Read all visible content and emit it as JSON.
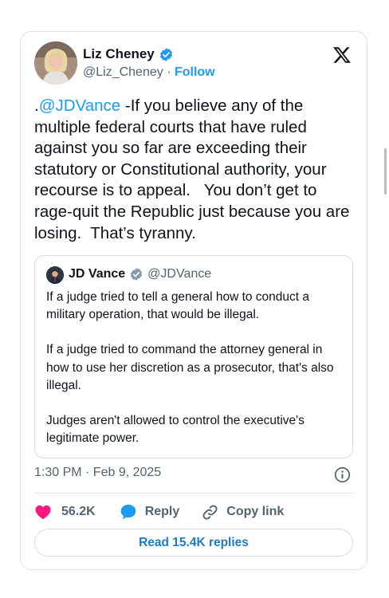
{
  "tweet": {
    "author": {
      "name": "Liz Cheney",
      "handle": "@Liz_Cheney",
      "separator": " · ",
      "follow_label": "Follow",
      "avatar_icon": "person-portrait",
      "verified_icon": "verified-badge-icon"
    },
    "body": {
      "prefix": ".",
      "mention": "@JDVance",
      "text": " -If you believe any of the multiple federal courts that have ruled against you so far are exceeding their statutory or Constitutional authority, your recourse is to appeal.   You don’t get to rage-quit the Republic just because you are losing.  That’s tyranny."
    },
    "quoted": {
      "name": "JD Vance",
      "handle": "@JDVance",
      "paragraphs": [
        "If a judge tried to tell a general how to conduct a military operation, that would be illegal.",
        "If a judge tried to command the attorney general in how to use her discretion as a prosecutor, that's also illegal.",
        "Judges aren't allowed to control the executive's legitimate power."
      ]
    },
    "timestamp": "1:30 PM · Feb 9, 2025",
    "actions": {
      "likes": "56.2K",
      "reply_label": "Reply",
      "copy_link_label": "Copy link"
    },
    "read_replies_label": "Read 15.4K replies"
  },
  "colors": {
    "accent": "#1d9bf0",
    "like": "#f91880",
    "secondary_text": "#536471",
    "border": "#dfe3e8"
  }
}
